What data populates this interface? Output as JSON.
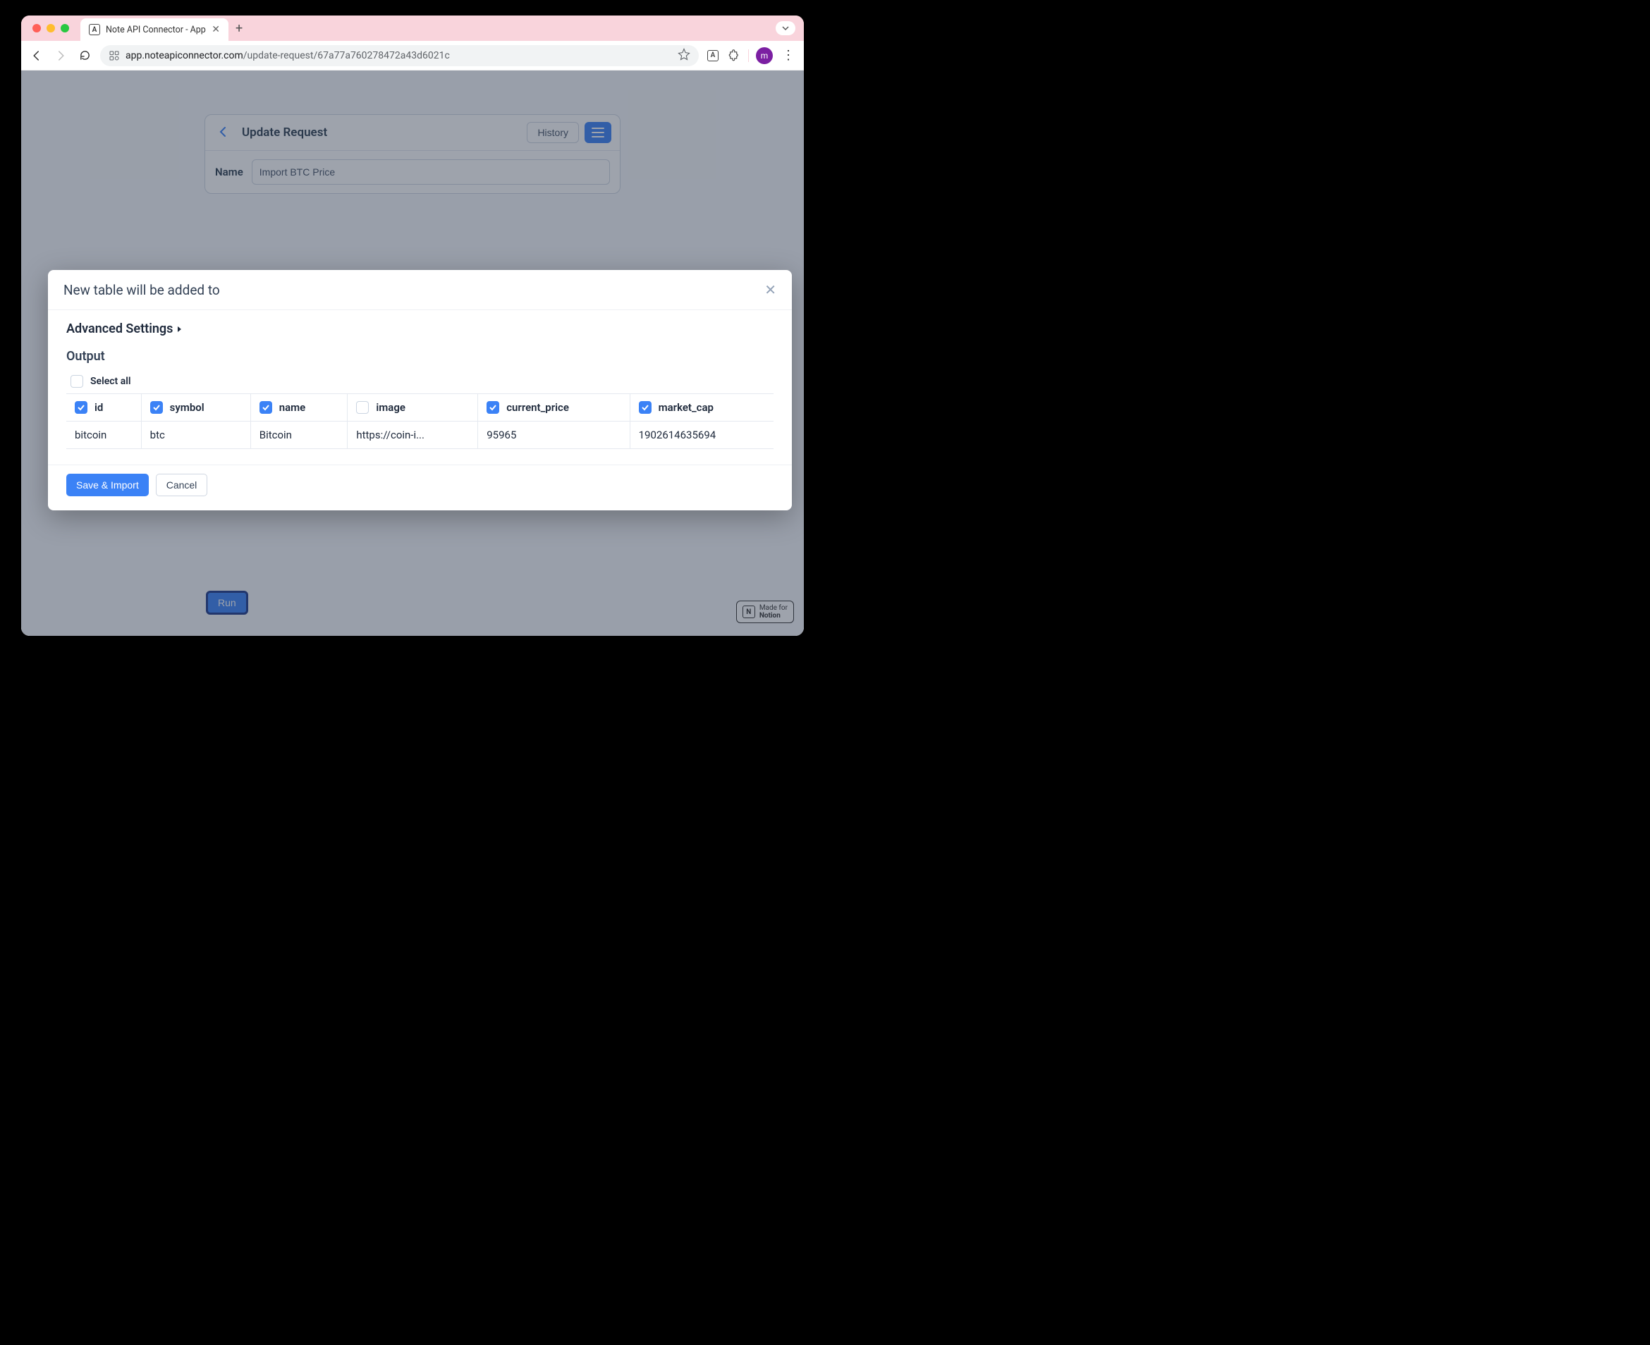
{
  "browser": {
    "tab_title": "Note API Connector - App",
    "url_domain": "app.noteapiconnector.com",
    "url_path": "/update-request/67a77a760278472a43d6021c",
    "avatar_letter": "m"
  },
  "page": {
    "title": "Update Request",
    "history_label": "History",
    "name_label": "Name",
    "name_value": "Import BTC Price",
    "run_label": "Run",
    "made_for": "Made for",
    "notion": "Notion"
  },
  "modal": {
    "title": "New table will be added to",
    "advanced_label": "Advanced Settings",
    "output_label": "Output",
    "select_all_label": "Select all",
    "save_label": "Save & Import",
    "cancel_label": "Cancel",
    "columns": [
      {
        "key": "id",
        "checked": true
      },
      {
        "key": "symbol",
        "checked": true
      },
      {
        "key": "name",
        "checked": true
      },
      {
        "key": "image",
        "checked": false
      },
      {
        "key": "current_price",
        "checked": true
      },
      {
        "key": "market_cap",
        "checked": true
      }
    ],
    "row": {
      "id": "bitcoin",
      "symbol": "btc",
      "name": "Bitcoin",
      "image": "https://coin-i...",
      "current_price": "95965",
      "market_cap": "1902614635694"
    }
  }
}
